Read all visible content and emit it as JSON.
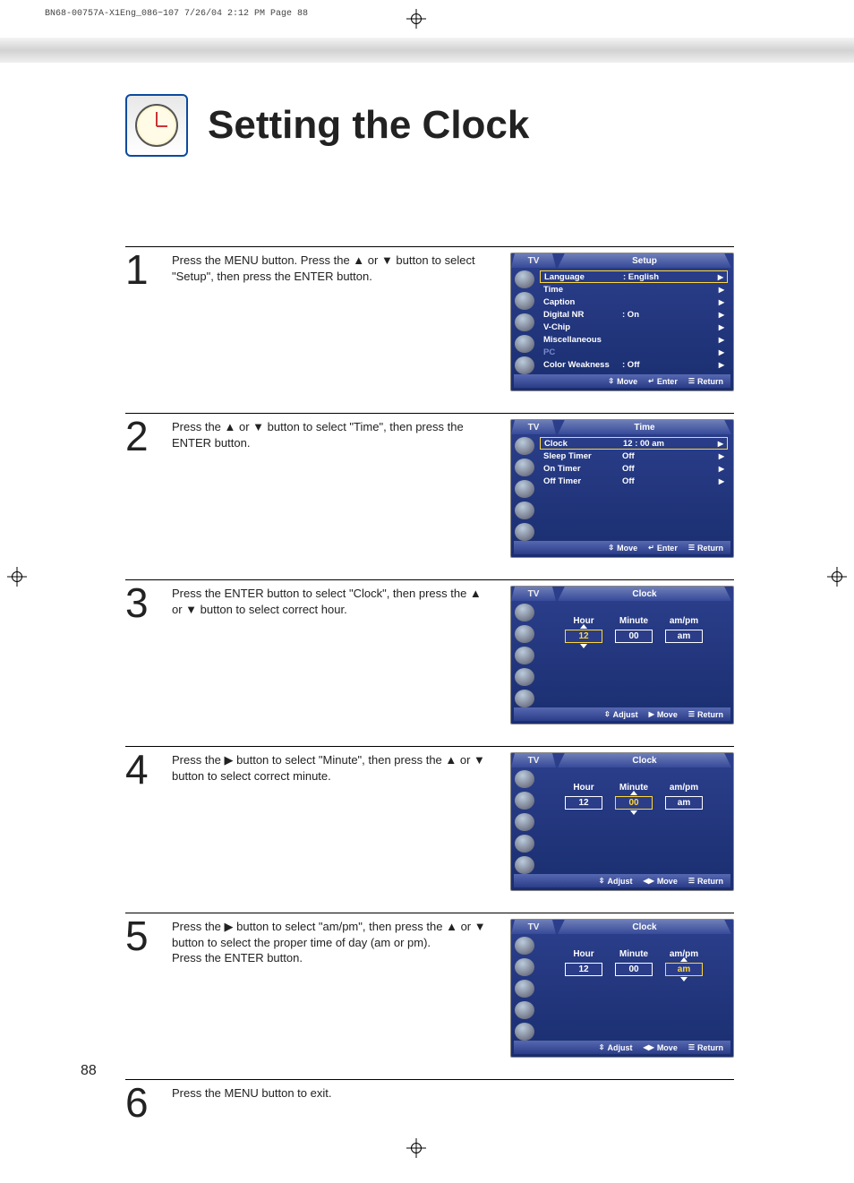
{
  "meta_header": "BN68-00757A-X1Eng_086~107  7/26/04  2:12 PM  Page 88",
  "page_title": "Setting the Clock",
  "page_number": "88",
  "tv_label": "TV",
  "steps": [
    {
      "num": "1",
      "text": "Press the MENU button. Press the ▲ or ▼ button to select \"Setup\", then press the ENTER button."
    },
    {
      "num": "2",
      "text": "Press the ▲ or ▼ button to select \"Time\", then press the ENTER button."
    },
    {
      "num": "3",
      "text": "Press the ENTER button to select \"Clock\", then press the ▲ or ▼ button to select correct hour."
    },
    {
      "num": "4",
      "text": "Press the ▶ button to select \"Minute\", then press the ▲ or ▼ button to select correct minute."
    },
    {
      "num": "5",
      "text": "Press the ▶ button to select \"am/pm\", then press the ▲ or ▼ button to select the proper time of day (am or pm).\nPress the ENTER button."
    },
    {
      "num": "6",
      "text": "Press the MENU button to exit."
    }
  ],
  "osd1": {
    "title": "Setup",
    "rows": [
      {
        "label": "Language",
        "value": ":  English",
        "sel": true
      },
      {
        "label": "Time",
        "value": "",
        "sel": false
      },
      {
        "label": "Caption",
        "value": "",
        "sel": false
      },
      {
        "label": "Digital NR",
        "value": ":  On",
        "sel": false
      },
      {
        "label": "V-Chip",
        "value": "",
        "sel": false
      },
      {
        "label": "Miscellaneous",
        "value": "",
        "sel": false
      },
      {
        "label": "PC",
        "value": "",
        "sel": false,
        "dim": true
      },
      {
        "label": "Color Weakness",
        "value": ":  Off",
        "sel": false
      }
    ],
    "foot": {
      "a": "Move",
      "b": "Enter",
      "c": "Return"
    }
  },
  "osd2": {
    "title": "Time",
    "rows": [
      {
        "label": "Clock",
        "value": "12 : 00 am",
        "sel": true
      },
      {
        "label": "Sleep Timer",
        "value": "Off",
        "sel": false
      },
      {
        "label": "On Timer",
        "value": "Off",
        "sel": false
      },
      {
        "label": "Off Timer",
        "value": "Off",
        "sel": false
      }
    ],
    "foot": {
      "a": "Move",
      "b": "Enter",
      "c": "Return"
    }
  },
  "osd_clock": {
    "title": "Clock",
    "labels": {
      "h": "Hour",
      "m": "Minute",
      "a": "am/pm"
    },
    "values": {
      "h": "12",
      "m": "00",
      "a": "am"
    },
    "foot": {
      "a": "Adjust",
      "b": "Move",
      "c": "Return"
    }
  },
  "nav_glyphs": {
    "updown": "⇳",
    "enter": "↵",
    "return": "☰",
    "right": "▶",
    "leftright": "◀▶"
  }
}
